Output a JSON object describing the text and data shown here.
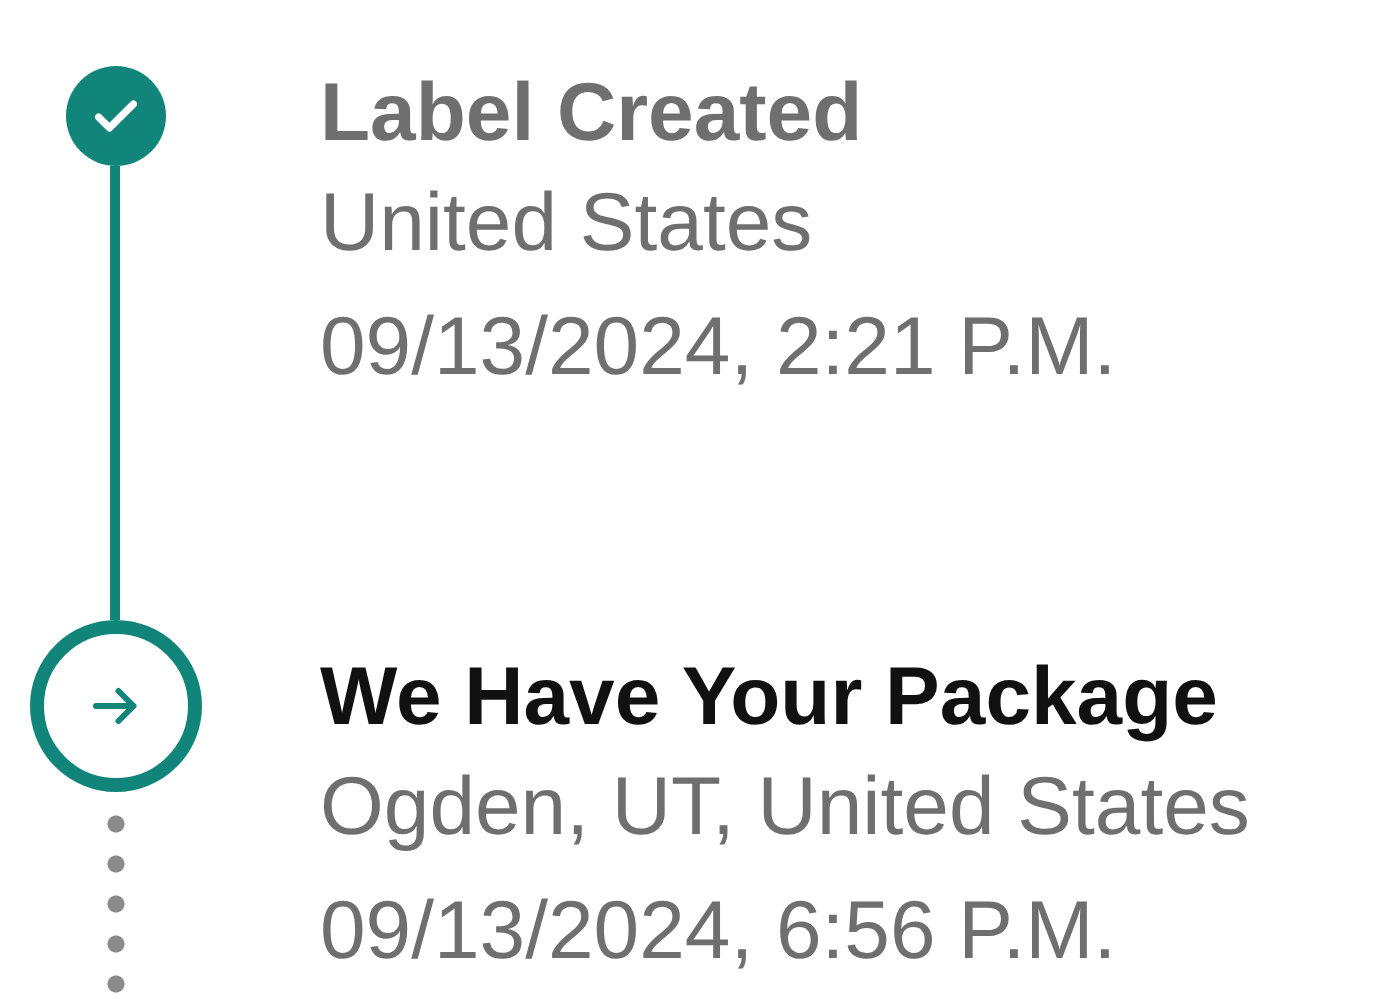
{
  "events": [
    {
      "kind": "completed",
      "title": "Label Created",
      "location": "United States",
      "time": "09/13/2024, 2:21 P.M."
    },
    {
      "kind": "current",
      "title": "We Have Your Package",
      "location": "Ogden, UT, United States",
      "time": "09/13/2024, 6:56 P.M."
    }
  ]
}
